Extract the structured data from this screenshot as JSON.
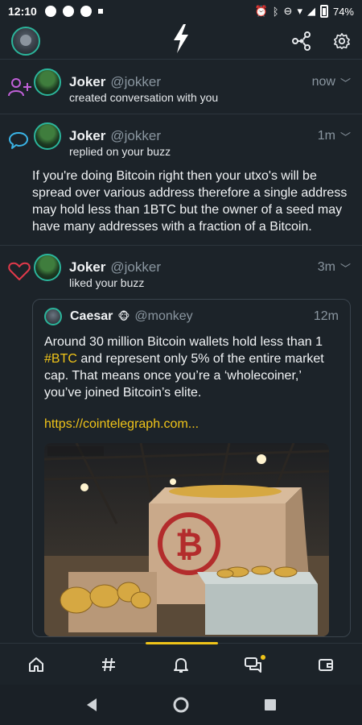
{
  "status_bar": {
    "time": "12:10",
    "battery": "74%"
  },
  "feed": [
    {
      "type": "conversation",
      "name": "Joker",
      "handle": "@jokker",
      "time": "now",
      "action": "created conversation with you"
    },
    {
      "type": "reply",
      "name": "Joker",
      "handle": "@jokker",
      "time": "1m",
      "action": "replied on your buzz",
      "content": "If you're doing Bitcoin right then your utxo's will be spread over various address therefore a single address may hold less than 1BTC but the owner of a seed may have many addresses with a fraction of a Bitcoin."
    },
    {
      "type": "like",
      "name": "Joker",
      "handle": "@jokker",
      "time": "3m",
      "action": "liked your buzz",
      "quote": {
        "name": "Caesar",
        "badge": "🐵",
        "handle": "@monkey",
        "time": "12m",
        "text_before": "Around 30 million Bitcoin wallets hold less than 1 ",
        "hashtag": "#BTC",
        "text_after": " and represent only 5% of the entire market cap. That means once you’re a ‘wholecoiner,’ you’ve joined Bitcoin’s elite.",
        "link": "https://cointelegraph.com..."
      }
    }
  ],
  "bottom_nav": [
    "home-icon",
    "hashtag-icon",
    "bell-icon",
    "chat-icon",
    "wallet-icon"
  ],
  "colors": {
    "accent": "#f0c419",
    "teal": "#2bb59b",
    "background": "#1c2329"
  }
}
